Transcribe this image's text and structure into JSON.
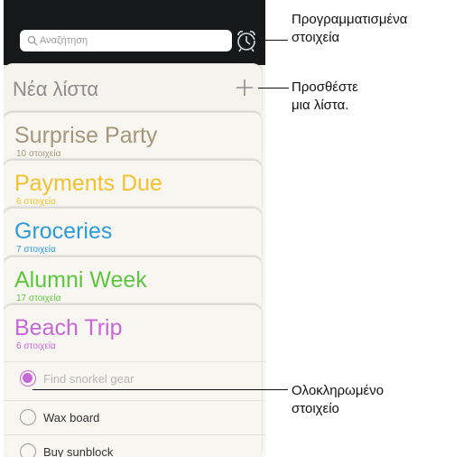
{
  "search": {
    "placeholder": "Αναζήτηση"
  },
  "new_list": {
    "label": "Νέα λίστα"
  },
  "lists": [
    {
      "title": "Surprise Party",
      "count": "10 στοιχεία",
      "color": "#a6977c"
    },
    {
      "title": "Payments Due",
      "count": "6 στοιχεία",
      "color": "#f2c12e"
    },
    {
      "title": "Groceries",
      "count": "7 στοιχεία",
      "color": "#2e9bd9"
    },
    {
      "title": "Alumni Week",
      "count": "17 στοιχεία",
      "color": "#5ec63e"
    },
    {
      "title": "Beach Trip",
      "count": "6 στοιχεία",
      "color": "#c667d6"
    }
  ],
  "items": [
    {
      "text": "Find snorkel gear",
      "completed": true
    },
    {
      "text": "Wax board",
      "completed": false
    },
    {
      "text": "Buy sunblock",
      "completed": false
    }
  ],
  "callouts": {
    "scheduled": [
      "Προγραμματισμένα",
      "στοιχεία"
    ],
    "add_list": [
      "Προσθέστε",
      "μια λίστα."
    ],
    "completed": [
      "Ολοκληρωμένο",
      "στοιχείο"
    ]
  },
  "icons": {
    "search": "search-icon",
    "alarm": "alarm-clock-icon",
    "plus": "plus-icon"
  },
  "colors": {
    "topbar": "#17181a",
    "paper": "#f7f6f1",
    "completed_circle": "#c667d6"
  }
}
